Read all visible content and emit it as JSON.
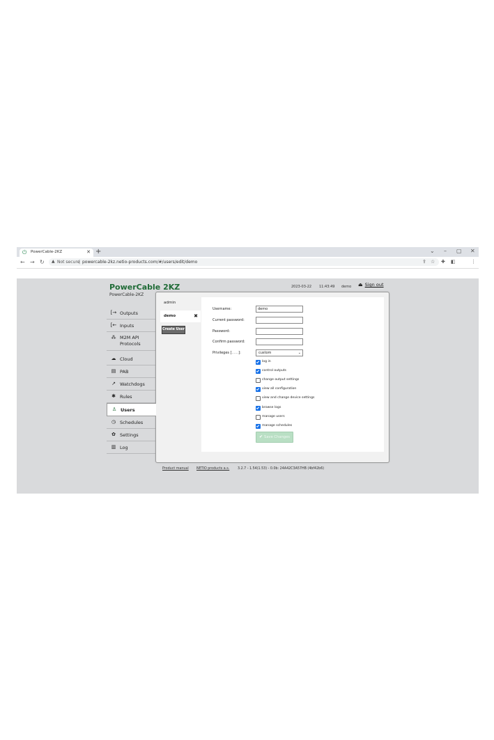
{
  "browser": {
    "tab_title": "PowerCable-2KZ",
    "tab_close": "✕",
    "new_tab": "+",
    "url_warning": "Not secure",
    "url_sep": "|",
    "url": "powercable-2kz.netio-products.com/#/users/edit/demo"
  },
  "header": {
    "brand": "PowerCable 2KZ",
    "device_name": "PowerCable-2KZ",
    "date": "2023-03-22",
    "time": "11:43:49",
    "user": "demo",
    "sign_out": "Sign out"
  },
  "sidebar": {
    "items": [
      {
        "label": "Outputs",
        "icon": "output-icon",
        "glyph": "[→"
      },
      {
        "label": "Inputs",
        "icon": "input-icon",
        "glyph": "[←"
      },
      {
        "label": "M2M API",
        "label2": "Protocols",
        "icon": "network-icon",
        "glyph": "⁂"
      },
      {
        "label": "Cloud",
        "icon": "cloud-icon",
        "glyph": "☁"
      },
      {
        "label": "PAB",
        "icon": "document-icon",
        "glyph": "▤"
      },
      {
        "label": "Watchdogs",
        "icon": "pulse-icon",
        "glyph": "↗"
      },
      {
        "label": "Rules",
        "icon": "wand-icon",
        "glyph": "✱"
      },
      {
        "label": "Users",
        "icon": "user-icon",
        "glyph": "♙"
      },
      {
        "label": "Schedules",
        "icon": "clock-icon",
        "glyph": "◷"
      },
      {
        "label": "Settings",
        "icon": "gear-icon",
        "glyph": "✿"
      },
      {
        "label": "Log",
        "icon": "log-icon",
        "glyph": "▥"
      }
    ],
    "active": "Users"
  },
  "users": {
    "list": [
      "admin",
      "demo"
    ],
    "selected": "demo",
    "create_label": "Create User"
  },
  "form": {
    "username_label": "Username:",
    "username_value": "demo",
    "current_password_label": "Current password:",
    "password_label": "Password:",
    "confirm_password_label": "Confirm password:",
    "privileges_label": "Privileges [",
    "privileges_link": "......",
    "privileges_close": "]:",
    "privileges_value": "custom",
    "permissions": [
      {
        "label": "log in",
        "checked": true
      },
      {
        "label": "control outputs",
        "checked": true
      },
      {
        "label": "change output settings",
        "checked": false
      },
      {
        "label": "view all configuration",
        "checked": true
      },
      {
        "label": "view and change device settings",
        "checked": false
      },
      {
        "label": "browse logs",
        "checked": true
      },
      {
        "label": "manage users",
        "checked": false
      },
      {
        "label": "manage schedules",
        "checked": true
      }
    ],
    "save_label": "Save Changes"
  },
  "footer": {
    "manual": "Product manual",
    "company": "NETIO products a.s.",
    "version": "3.2.7 - 1.54(1.53) - 0.0b: 24A42C3A57HB (4bf42b6)"
  },
  "colors": {
    "brand": "#1f6b36",
    "checkbox_on": "#1a73e8",
    "save_disabled": "#b9dfc4"
  }
}
